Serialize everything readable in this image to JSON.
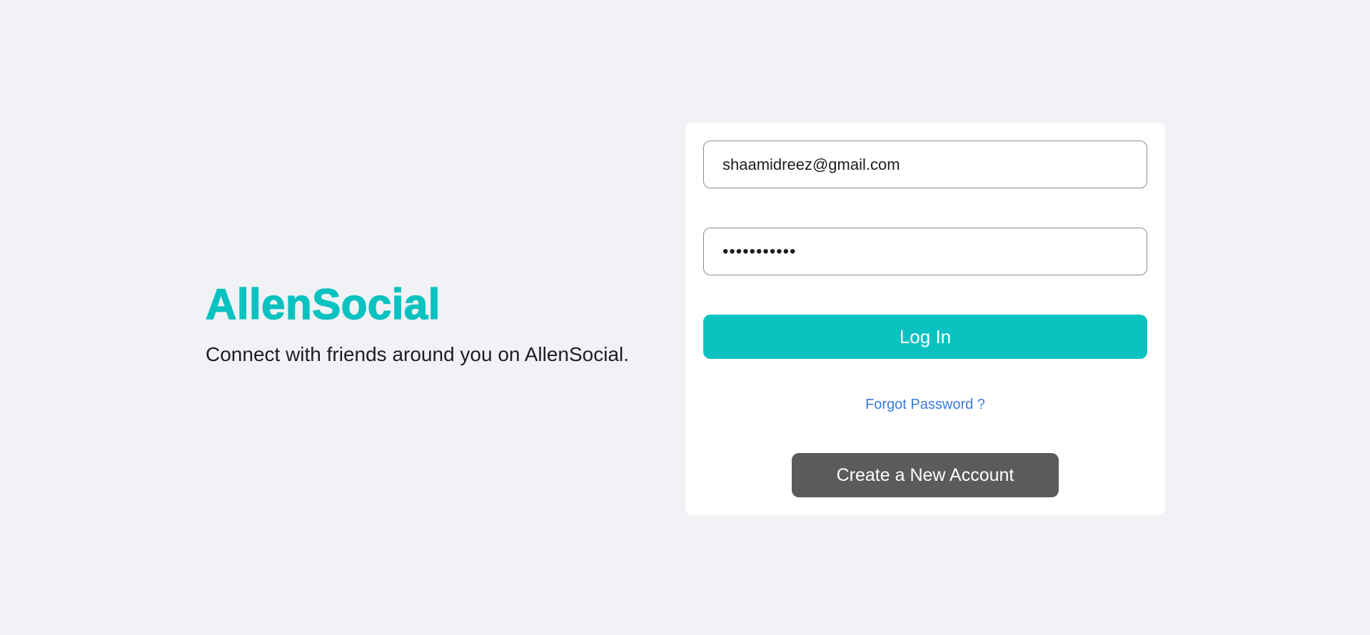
{
  "colors": {
    "page_background": "#f0f2f5",
    "brand": "#0ac2c0",
    "primary_button": "#0ac2c0",
    "secondary_button": "#595c5a",
    "link": "#3b7ae0"
  },
  "brand": {
    "name": "AllenSocial",
    "tagline": "Connect with friends around you on AllenSocial."
  },
  "login": {
    "email_value": "shaamidreez@gmail.com",
    "password_masked": "•••••••••••",
    "login_label": "Log In",
    "forgot_label": "Forgot Password ?",
    "create_label": "Create a New Account"
  }
}
